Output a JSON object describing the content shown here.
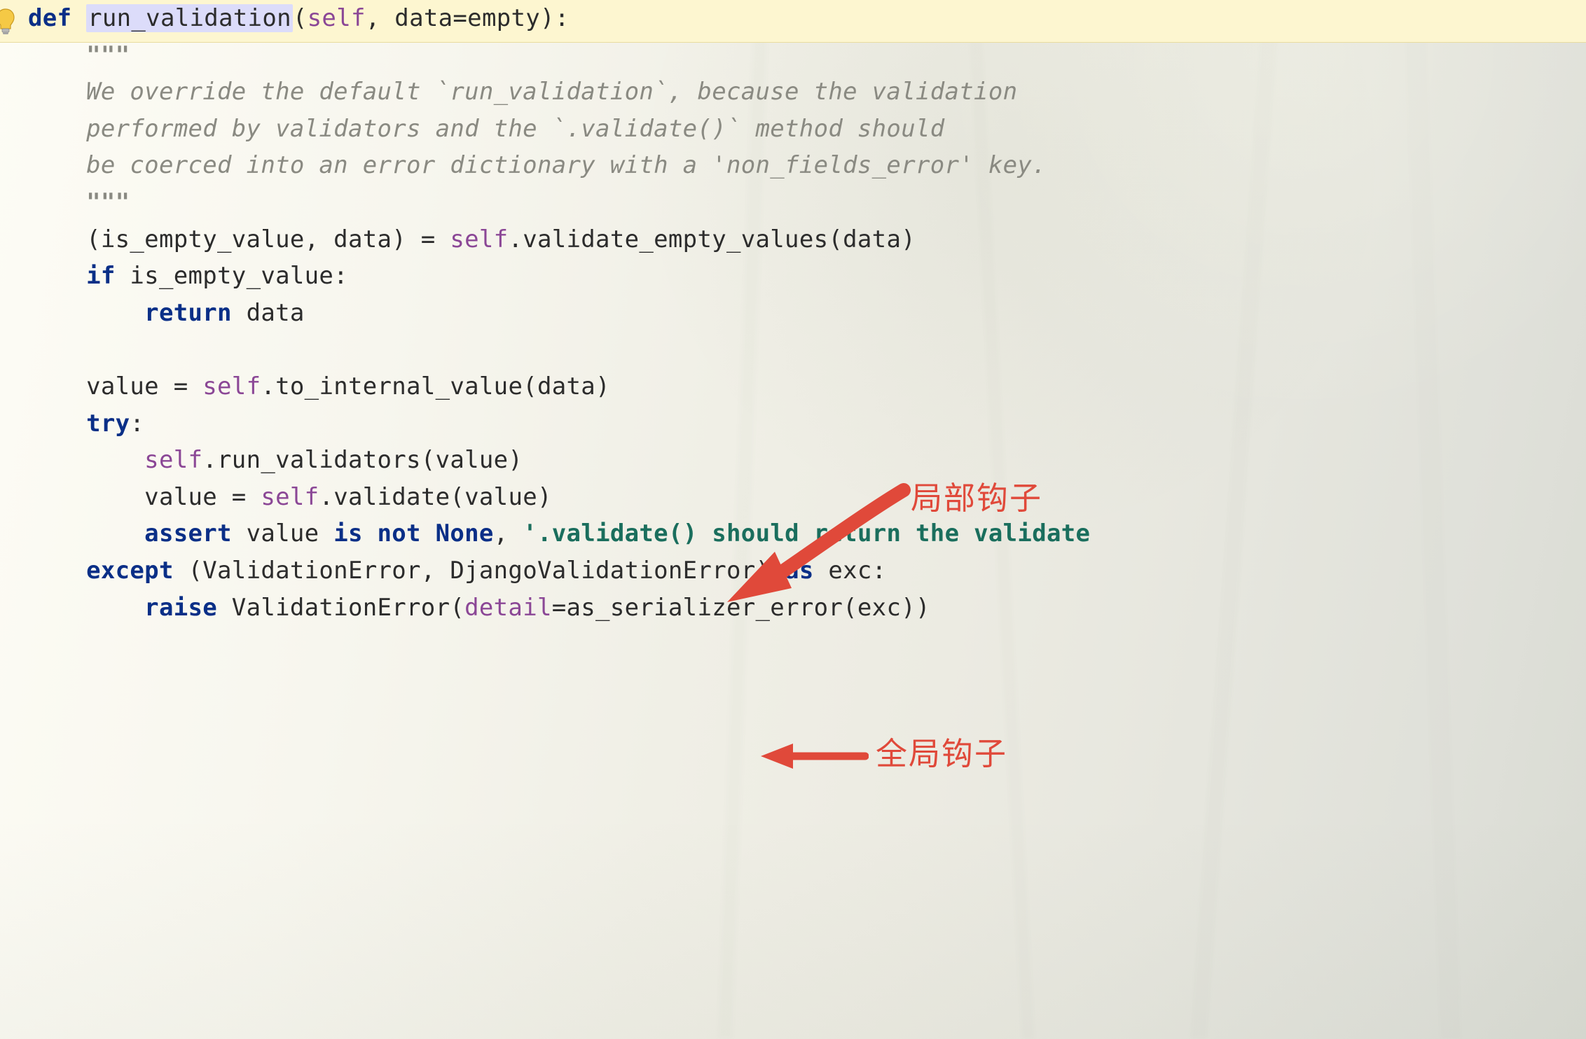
{
  "code": {
    "def": "def",
    "fn_name": "run_validation",
    "sig_open": "(",
    "self": "self",
    "sig_sep": ", ",
    "param_data": "data",
    "eq": "=",
    "param_default": "empty",
    "sig_close": ")",
    "colon": ":",
    "docq_open": "\"\"\"",
    "doc_l1": "We override the default `run_validation`, because the validation",
    "doc_l2": "performed by validators and the `.validate()` method should",
    "doc_l3": "be coerced into an error dictionary with a 'non_fields_error' key.",
    "docq_close": "\"\"\"",
    "l_assign_open": "(is_empty_value, data) = ",
    "l_assign_self": "self",
    "l_assign_call": ".validate_empty_values(data)",
    "if_kw": "if",
    "if_cond": " is_empty_value:",
    "return_kw": "return",
    "return_val": " data",
    "val_assign_pre": "value = ",
    "val_assign_self": "self",
    "val_assign_call": ".to_internal_value(data)",
    "try_kw": "try",
    "try_colon": ":",
    "rv_self": "self",
    "rv_call": ".run_validators(value)",
    "vv_pre": "value = ",
    "vv_self": "self",
    "vv_call": ".validate(value)",
    "assert_kw": "assert",
    "assert_mid": " value ",
    "is_kw": "is",
    "not_kw": "not",
    "none_kw": "None",
    "assert_sep": ", ",
    "assert_str": "'.validate() should return the validate",
    "except_kw": "except",
    "except_tuple": " (ValidationError, DjangoValidationError) ",
    "as_kw": "as",
    "exc_name": " exc:",
    "raise_kw": "raise",
    "raise_pre": " ValidationError(",
    "detail_kw": "detail",
    "raise_rest": "=as_serializer_error(exc))"
  },
  "annotations": {
    "local_hook": "局部钩子",
    "global_hook": "全局钩子"
  },
  "colors": {
    "keyword": "#0a2f87",
    "self": "#8b4796",
    "docstring": "#8a8a82",
    "string": "#1a6e5d",
    "annotation": "#e0493a",
    "highlight_bg": "#dcdcfa",
    "topbar_bg": "#fdf6d0"
  }
}
